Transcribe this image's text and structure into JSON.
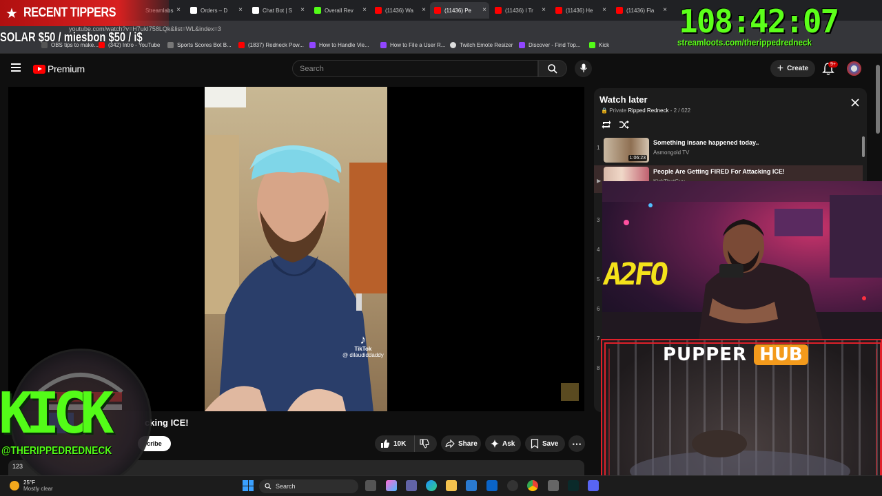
{
  "browser": {
    "tabs": [
      {
        "label": "Streamlabs",
        "color": "#80f0c0"
      },
      {
        "label": "Orders – D",
        "color": "#ffffff"
      },
      {
        "label": "Chat Bot | S",
        "color": "#ffffff"
      },
      {
        "label": "Overall Rev",
        "color": "#53fc18"
      },
      {
        "label": "(11436) Wa",
        "color": "#ff0000"
      },
      {
        "label": "(11436) Pe",
        "color": "#ff0000"
      },
      {
        "label": "(11436) I Tr",
        "color": "#ff0000"
      },
      {
        "label": "(11436) He",
        "color": "#ff0000"
      },
      {
        "label": "(11436) Fla",
        "color": "#ff0000"
      }
    ],
    "url": "youtube.com/watch?v=H7ukI758LQk&list=WL&index=3",
    "bookmarks": [
      {
        "label": "OBS tips to make...",
        "color": "#555"
      },
      {
        "label": "(342) Intro - YouTube",
        "color": "#ff0000"
      },
      {
        "label": "Sports Scores Bot B...",
        "color": "#777"
      },
      {
        "label": "(1837) Redneck Pow...",
        "color": "#ff0000"
      },
      {
        "label": "How to Handle Vie...",
        "color": "#9146ff"
      },
      {
        "label": "How to File a User R...",
        "color": "#9146ff"
      },
      {
        "label": "Twitch Emote Resizer",
        "color": "#ddd"
      },
      {
        "label": "Discover - Find Top...",
        "color": "#9146ff"
      },
      {
        "label": "Kick",
        "color": "#53fc18"
      }
    ]
  },
  "overlay": {
    "tip_banner": "RECENT TIPPERS",
    "tip_scroll": "SOLAR $50 /                  miesbon $50 / i$",
    "timer": "108:42:07",
    "loot_link": "streamloots.com/therippedredneck",
    "pupper_word": "PUPPER",
    "hub_word": "HUB",
    "kick_word": "KICK",
    "kick_handle": "@THERIPPEDREDNECK",
    "webcam_sign": "A2FO"
  },
  "youtube": {
    "logo_text": "Premium",
    "search_placeholder": "Search",
    "create_label": "Create",
    "notification_badge": "9+",
    "video": {
      "title_partial": "cking ICE!",
      "subscribe_partial": "cribe",
      "tiktok_brand": "TikTok",
      "tiktok_handle": "@ dilaudiddaddy",
      "likes": "10K",
      "share_label": "Share",
      "ask_label": "Ask",
      "save_label": "Save",
      "more_label": "⋯",
      "views_partial": "123"
    },
    "watch_later": {
      "title": "Watch later",
      "privacy": "Private",
      "owner": "Ripped Redneck",
      "position": "- 2 / 622",
      "items": [
        {
          "num": "1",
          "title": "Something insane happened today..",
          "channel": "Asmongold TV",
          "duration": "1:06:23"
        },
        {
          "num": "▶",
          "title": "People Are Getting FIRED For Attacking ICE!",
          "channel": "KickThatGuy",
          "duration": ""
        }
      ],
      "hidden_numbers": [
        "3",
        "4",
        "5",
        "6",
        "7",
        "8"
      ]
    }
  },
  "taskbar": {
    "temp": "25°F",
    "condition": "Mostly clear",
    "search_label": "Search"
  }
}
